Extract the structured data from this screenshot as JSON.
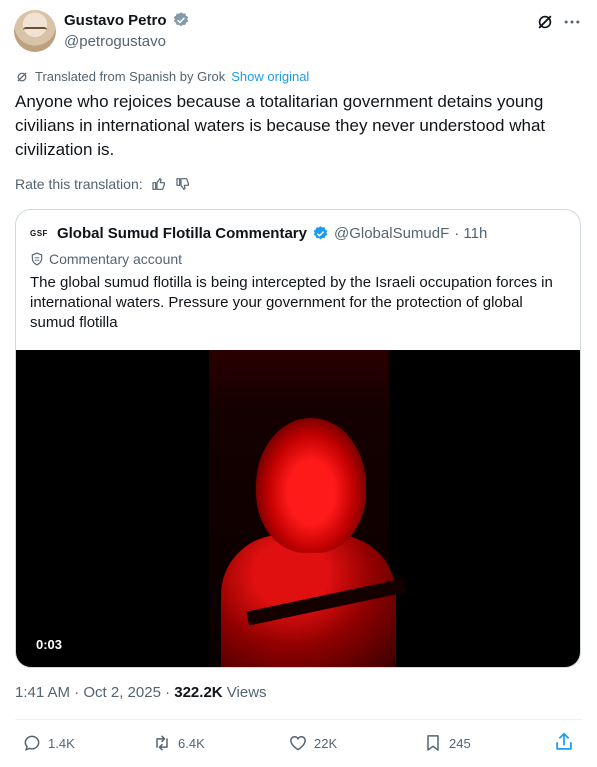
{
  "author": {
    "name": "Gustavo Petro",
    "handle": "@petrogustavo"
  },
  "translation": {
    "note": "Translated from Spanish by Grok",
    "show_original": "Show original",
    "rate_label": "Rate this translation:"
  },
  "tweet": {
    "text": "Anyone who rejoices because a totalitarian government detains young civilians in international waters is because they never understood what civilization is."
  },
  "quote": {
    "logo_text": "GSF",
    "name": "Global Sumud Flotilla Commentary",
    "handle": "@GlobalSumudF",
    "time": "· 11h",
    "label": "Commentary account",
    "text": "The global sumud flotilla is being intercepted by the Israeli occupation forces in international waters. Pressure your government for the protection of global sumud flotilla",
    "video_time": "0:03"
  },
  "meta": {
    "timestamp": "1:41 AM · Oct 2, 2025 · ",
    "views_count": "322.2K",
    "views_label": " Views"
  },
  "actions": {
    "replies": "1.4K",
    "reposts": "6.4K",
    "likes": "22K",
    "bookmarks": "245"
  },
  "colors": {
    "accent": "#1d9bf0",
    "muted": "#536471",
    "verified": "#1d9bf0"
  }
}
